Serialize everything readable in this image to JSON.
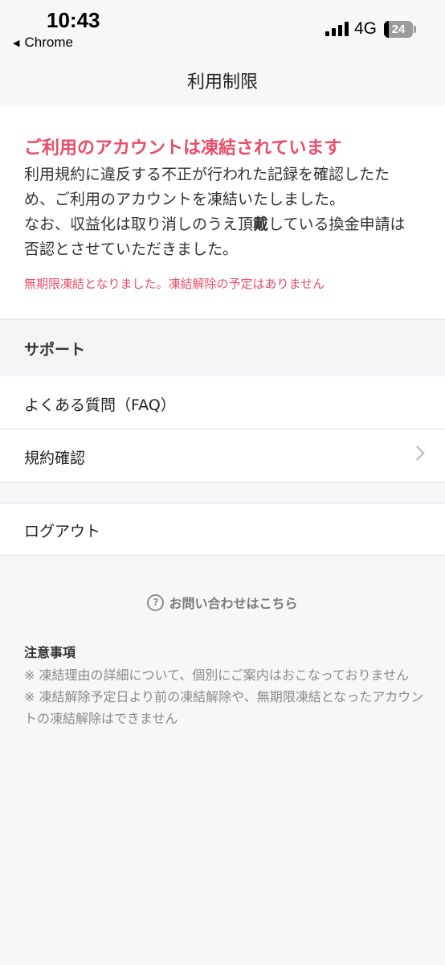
{
  "status_bar": {
    "time": "10:43",
    "back_app": "Chrome",
    "back_icon": "back-triangle-icon",
    "network": "4G",
    "battery": "24"
  },
  "header": {
    "title": "利用制限"
  },
  "notice": {
    "title": "ご利用のアカウントは凍結されています",
    "body_line1": "利用規約に違反する不正が行われた記録を確認したため、ご利用のアカウントを凍結いたしました。",
    "body_line2a": "なお、収益化は取り消しのうえ頂",
    "body_line2b": "戴",
    "body_line2c": "している換金申請は否認とさせていただきました。",
    "warning": "無期限凍結となりました。凍結解除の予定はありません",
    "accent_color": "#ea4d69"
  },
  "support": {
    "heading": "サポート",
    "faq_label": "よくある質問（FAQ）",
    "terms_label": "規約確認",
    "logout_label": "ログアウト"
  },
  "contact": {
    "label": "お問い合わせはこちら",
    "icon": "question-circle-icon"
  },
  "notes": {
    "title": "注意事項",
    "items": [
      "※ 凍結理由の詳細について、個別にご案内はおこなっておりません",
      "※ 凍結解除予定日より前の凍結解除や、無期限凍結となったアカウントの凍結解除はできません"
    ]
  }
}
